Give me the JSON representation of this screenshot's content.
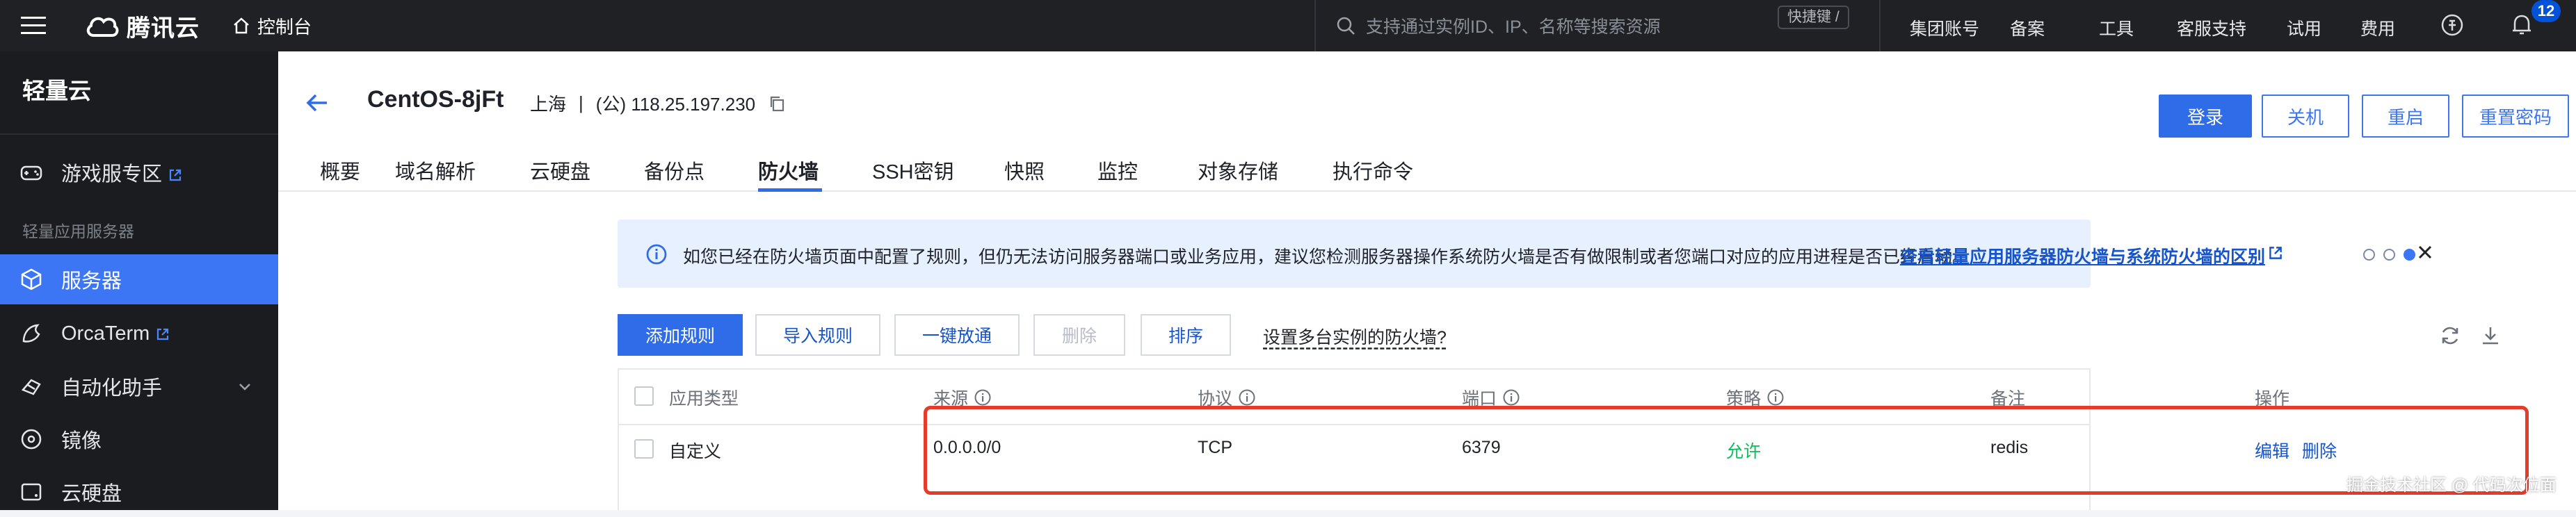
{
  "topbar": {
    "logo_text": "腾讯云",
    "console_label": "控制台",
    "search_placeholder": "支持通过实例ID、IP、名称等搜索资源",
    "shortcut_label": "快捷键 /",
    "links": [
      "集团账号",
      "备案",
      "工具",
      "客服支持",
      "试用",
      "费用"
    ],
    "notification_count": "12"
  },
  "sidebar": {
    "title": "轻量云",
    "items": [
      {
        "label": "游戏服专区"
      },
      {
        "label": "服务器"
      },
      {
        "label": "OrcaTerm"
      },
      {
        "label": "自动化助手"
      },
      {
        "label": "镜像"
      },
      {
        "label": "云硬盘"
      }
    ],
    "section_label": "轻量应用服务器"
  },
  "header": {
    "instance_name": "CentOS-8jFt",
    "region": "上海",
    "separator": "|",
    "ip": "(公) 118.25.197.230",
    "buttons": {
      "login": "登录",
      "shutdown": "关机",
      "restart": "重启",
      "reset_password": "重置密码"
    },
    "tabs": [
      "概要",
      "域名解析",
      "云硬盘",
      "备份点",
      "防火墙",
      "SSH密钥",
      "快照",
      "监控",
      "对象存储",
      "执行命令"
    ],
    "active_tab": "防火墙"
  },
  "notice": {
    "text": "如您已经在防火墙页面中配置了规则，但仍无法访问服务器端口或业务应用，建议您检测服务器操作系统防火墙是否有做限制或者您端口对应的应用进程是否已经启动。",
    "link_text": "查看轻量应用服务器防火墙与系统防火墙的区别",
    "pages": 3,
    "active_page": 3
  },
  "toolbar": {
    "add_rule": "添加规则",
    "import_rule": "导入规则",
    "allow_all": "一键放通",
    "delete": "删除",
    "sort": "排序",
    "multi_instance_link": "设置多台实例的防火墙?"
  },
  "table": {
    "columns": [
      "应用类型",
      "来源",
      "协议",
      "端口",
      "策略",
      "备注",
      "操作"
    ],
    "rows": [
      {
        "app_type": "自定义",
        "source": "0.0.0.0/0",
        "protocol": "TCP",
        "port": "6379",
        "policy": "允许",
        "remark": "redis",
        "edit": "编辑",
        "delete": "删除"
      }
    ]
  },
  "watermark": "掘金技术社区 @ 代码次位面",
  "colors": {
    "accent": "#2f6de8",
    "sidebar_active": "#3c76f5",
    "allow_green": "#0abf5b",
    "highlight_red": "#e53b2b"
  }
}
